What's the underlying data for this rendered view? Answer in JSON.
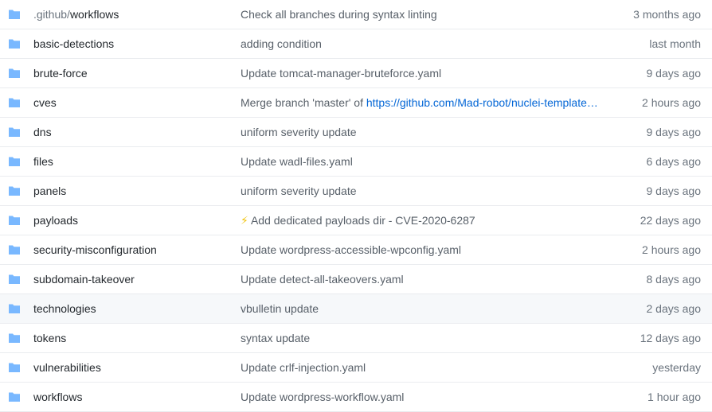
{
  "colors": {
    "folder_icon": "#79b8ff",
    "text": "#24292e",
    "muted": "#586069",
    "link": "#0366d6",
    "row_highlight": "#f6f8fa",
    "border": "#eaecef"
  },
  "rows": [
    {
      "icon": "folder-icon",
      "name_prefix": ".github/",
      "name": "workflows",
      "message": "Check all branches during syntax linting",
      "age": "3 months ago"
    },
    {
      "icon": "folder-icon",
      "name": "basic-detections",
      "message": "adding condition",
      "age": "last month"
    },
    {
      "icon": "folder-icon",
      "name": "brute-force",
      "message": "Update tomcat-manager-bruteforce.yaml",
      "age": "9 days ago"
    },
    {
      "icon": "folder-icon",
      "name": "cves",
      "message": "Merge branch 'master' of ",
      "message_link": "https://github.com/Mad-robot/nuclei-template…",
      "age": "2 hours ago"
    },
    {
      "icon": "folder-icon",
      "name": "dns",
      "message": "uniform severity update",
      "age": "9 days ago"
    },
    {
      "icon": "folder-icon",
      "name": "files",
      "message": "Update wadl-files.yaml",
      "age": "6 days ago"
    },
    {
      "icon": "folder-icon",
      "name": "panels",
      "message": "uniform severity update",
      "age": "9 days ago"
    },
    {
      "icon": "folder-icon",
      "name": "payloads",
      "message_emoji": "⚡",
      "message": " Add dedicated payloads dir - CVE-2020-6287",
      "age": "22 days ago"
    },
    {
      "icon": "folder-icon",
      "name": "security-misconfiguration",
      "message": "Update wordpress-accessible-wpconfig.yaml",
      "age": "2 hours ago"
    },
    {
      "icon": "folder-icon",
      "name": "subdomain-takeover",
      "message": "Update detect-all-takeovers.yaml",
      "age": "8 days ago"
    },
    {
      "icon": "folder-icon",
      "name": "technologies",
      "message": "vbulletin update",
      "age": "2 days ago",
      "highlighted": true
    },
    {
      "icon": "folder-icon",
      "name": "tokens",
      "message": "syntax update",
      "age": "12 days ago"
    },
    {
      "icon": "folder-icon",
      "name": "vulnerabilities",
      "message": "Update crlf-injection.yaml",
      "age": "yesterday"
    },
    {
      "icon": "folder-icon",
      "name": "workflows",
      "message": "Update wordpress-workflow.yaml",
      "age": "1 hour ago"
    }
  ]
}
